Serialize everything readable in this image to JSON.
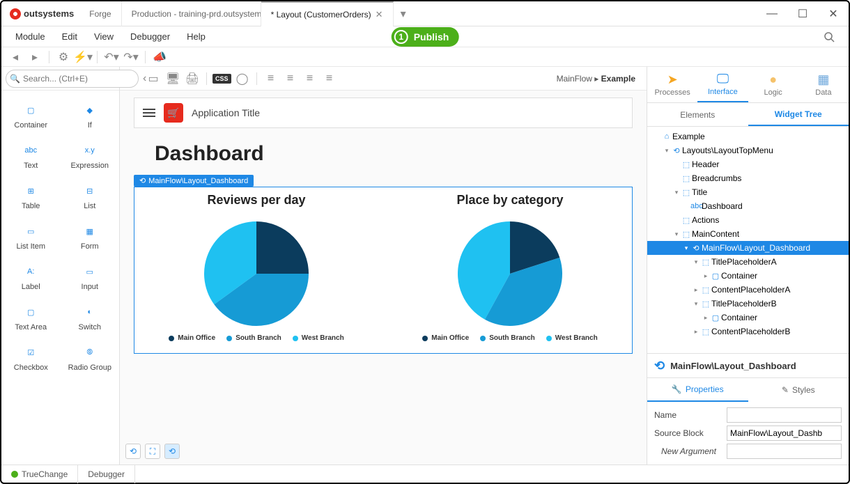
{
  "titlebar": {
    "brand": "outsystems",
    "tabs": [
      "Forge",
      "Production - training-prd.outsystem...",
      "* Layout (CustomerOrders)"
    ]
  },
  "menubar": [
    "Module",
    "Edit",
    "View",
    "Debugger",
    "Help"
  ],
  "publish": {
    "num": "1",
    "label": "Publish"
  },
  "toolbox": {
    "search_placeholder": "Search... (Ctrl+E)",
    "items": [
      {
        "label": "Container"
      },
      {
        "label": "If"
      },
      {
        "label": "Text"
      },
      {
        "label": "Expression"
      },
      {
        "label": "Table"
      },
      {
        "label": "List"
      },
      {
        "label": "List Item"
      },
      {
        "label": "Form"
      },
      {
        "label": "Label"
      },
      {
        "label": "Input"
      },
      {
        "label": "Text Area"
      },
      {
        "label": "Switch"
      },
      {
        "label": "Checkbox"
      },
      {
        "label": "Radio Group"
      }
    ]
  },
  "canvas": {
    "breadcrumb_root": "MainFlow",
    "breadcrumb_current": "Example",
    "app_title": "Application Title",
    "page_title": "Dashboard",
    "block_label": "MainFlow\\Layout_Dashboard"
  },
  "chart_data": [
    {
      "type": "pie",
      "title": "Reviews per day",
      "series": [
        {
          "name": "Main Office",
          "value": 25,
          "color": "#0b3c5d"
        },
        {
          "name": "South Branch",
          "value": 40,
          "color": "#169bd5"
        },
        {
          "name": "West Branch",
          "value": 35,
          "color": "#1fc1f1"
        }
      ]
    },
    {
      "type": "pie",
      "title": "Place by category",
      "series": [
        {
          "name": "Main Office",
          "value": 20,
          "color": "#0b3c5d"
        },
        {
          "name": "South Branch",
          "value": 38,
          "color": "#169bd5"
        },
        {
          "name": "West Branch",
          "value": 42,
          "color": "#1fc1f1"
        }
      ]
    }
  ],
  "right": {
    "main_tabs": [
      "Processes",
      "Interface",
      "Logic",
      "Data"
    ],
    "sub_tabs": [
      "Elements",
      "Widget Tree"
    ],
    "tree": [
      {
        "depth": 0,
        "icon": "home",
        "label": "Example",
        "arrow": ""
      },
      {
        "depth": 1,
        "icon": "block",
        "label": "Layouts\\LayoutTopMenu",
        "arrow": "▾"
      },
      {
        "depth": 2,
        "icon": "ph",
        "label": "Header",
        "arrow": ""
      },
      {
        "depth": 2,
        "icon": "ph",
        "label": "Breadcrumbs",
        "arrow": ""
      },
      {
        "depth": 2,
        "icon": "ph",
        "label": "Title",
        "arrow": "▾"
      },
      {
        "depth": 3,
        "icon": "abc",
        "label": "Dashboard",
        "arrow": ""
      },
      {
        "depth": 2,
        "icon": "ph",
        "label": "Actions",
        "arrow": ""
      },
      {
        "depth": 2,
        "icon": "ph",
        "label": "MainContent",
        "arrow": "▾"
      },
      {
        "depth": 3,
        "icon": "block",
        "label": "MainFlow\\Layout_Dashboard",
        "arrow": "▾",
        "selected": true
      },
      {
        "depth": 4,
        "icon": "ph",
        "label": "TitlePlaceholderA",
        "arrow": "▾"
      },
      {
        "depth": 5,
        "icon": "cont",
        "label": "Container",
        "arrow": "▸"
      },
      {
        "depth": 4,
        "icon": "ph",
        "label": "ContentPlaceholderA",
        "arrow": "▸"
      },
      {
        "depth": 4,
        "icon": "ph",
        "label": "TitlePlaceholderB",
        "arrow": "▾"
      },
      {
        "depth": 5,
        "icon": "cont",
        "label": "Container",
        "arrow": "▸"
      },
      {
        "depth": 4,
        "icon": "ph",
        "label": "ContentPlaceholderB",
        "arrow": "▸"
      }
    ],
    "props_title": "MainFlow\\Layout_Dashboard",
    "prop_tabs": [
      "Properties",
      "Styles"
    ],
    "props": {
      "name_label": "Name",
      "name_value": "",
      "src_label": "Source Block",
      "src_value": "MainFlow\\Layout_Dashb",
      "arg_label": "New Argument",
      "arg_value": ""
    }
  },
  "statusbar": {
    "truechange": "TrueChange",
    "debugger": "Debugger"
  }
}
